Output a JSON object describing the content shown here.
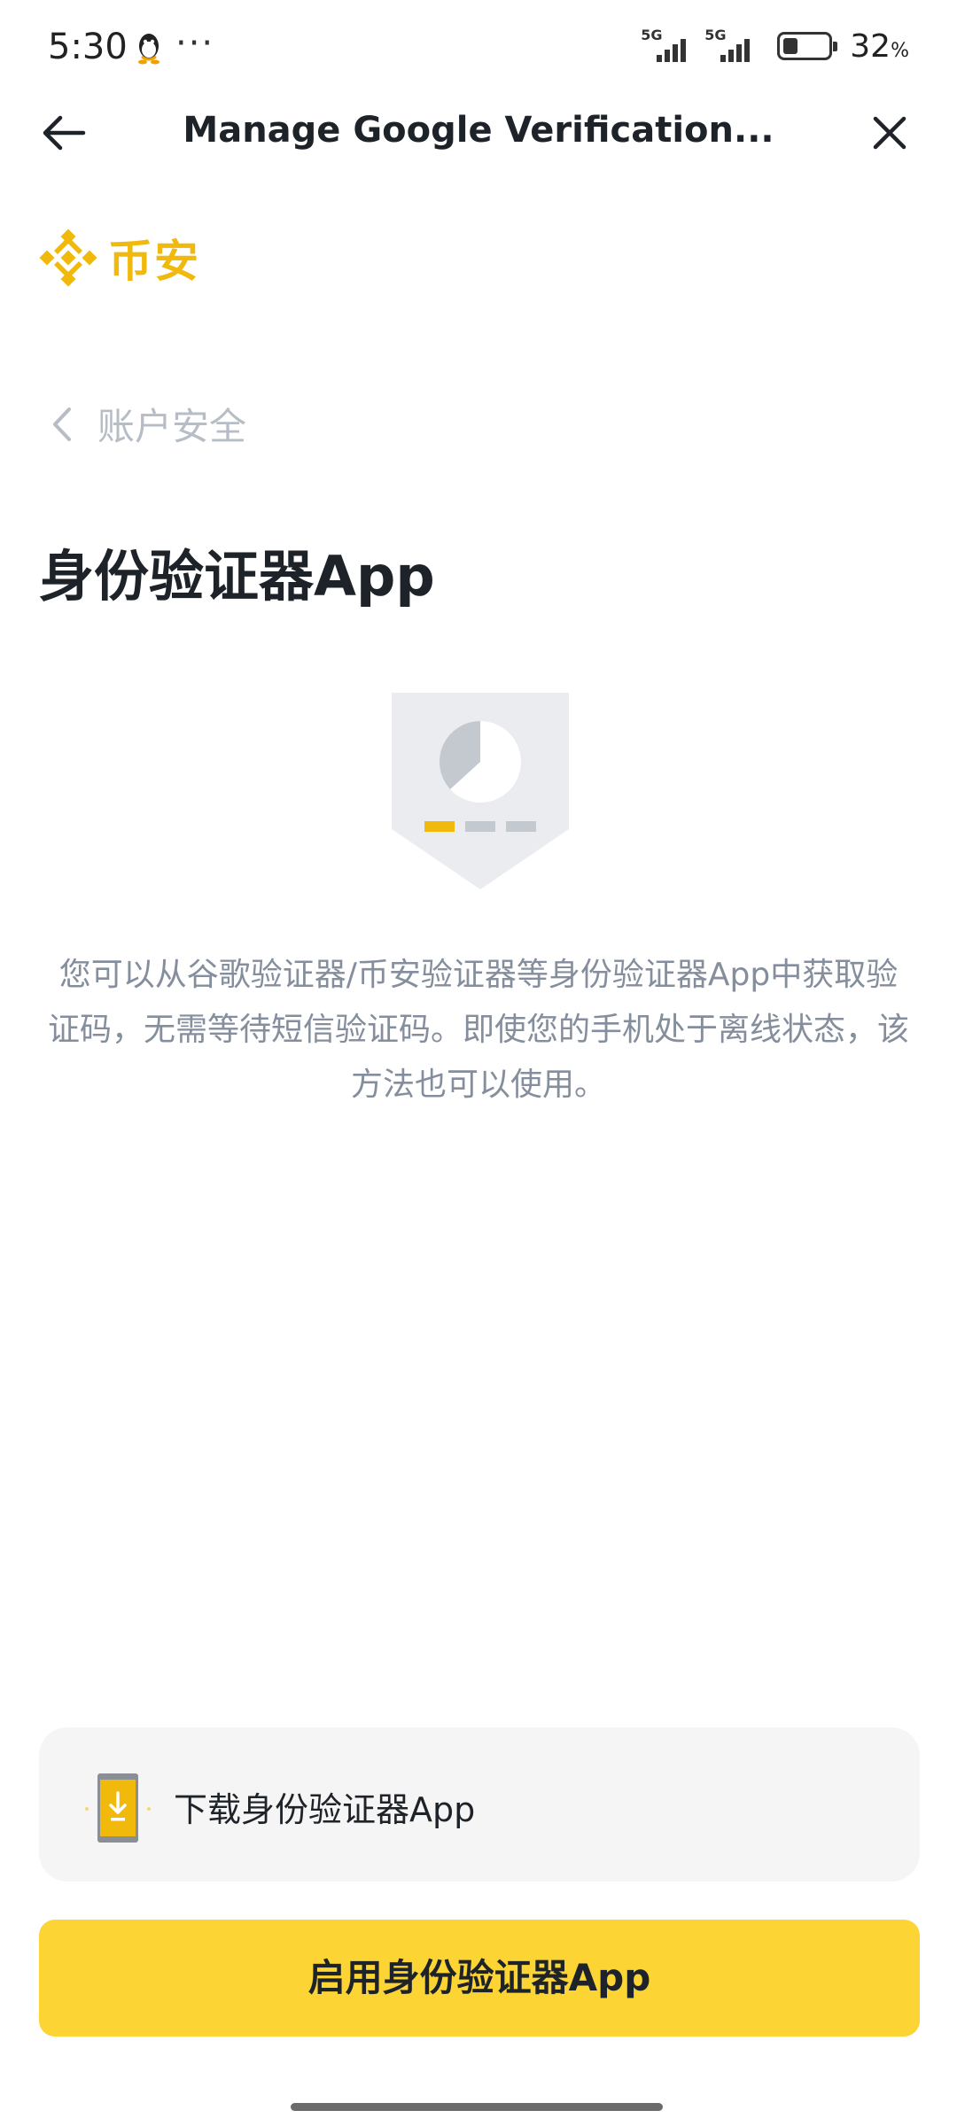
{
  "status_bar": {
    "time": "5:30",
    "more": "···",
    "net_1_label": "5G",
    "net_2_label": "5G",
    "battery_percent": "32",
    "battery_unit": "%",
    "battery_level": 0.32
  },
  "header": {
    "title": "Manage Google Verification...",
    "back_icon": "arrow-left-icon",
    "close_icon": "close-icon"
  },
  "logo": {
    "text": "币安"
  },
  "breadcrumb": {
    "label": "账户安全"
  },
  "main": {
    "title": "身份验证器App",
    "description": "您可以从谷歌验证器/币安验证器等身份验证器App中获取验证码，无需等待短信验证码。即使您的手机处于离线状态，该方法也可以使用。"
  },
  "download": {
    "label": "下载身份验证器App",
    "icon": "phone-download-icon"
  },
  "actions": {
    "enable_label": "启用身份验证器App"
  },
  "colors": {
    "brand": "#F0B90B",
    "button": "#FCD535",
    "muted": "#848E9C"
  }
}
